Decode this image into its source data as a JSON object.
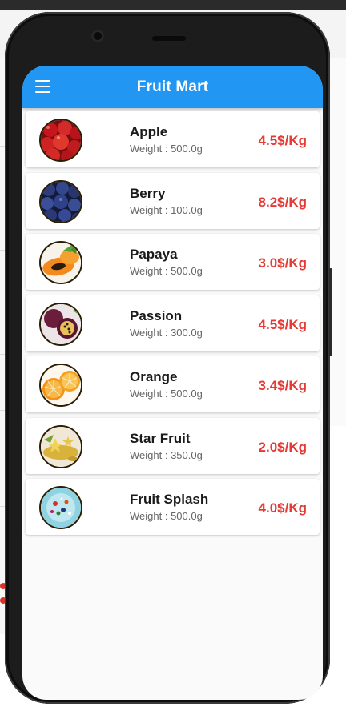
{
  "app": {
    "title": "Fruit Mart"
  },
  "theme": {
    "appbar": "#2196f3",
    "price": "#e53935"
  },
  "weight_label": "Weight : ",
  "items": [
    {
      "name": "Apple",
      "weight": "500.0g",
      "price": "4.5$/Kg",
      "icon": "apple-photo"
    },
    {
      "name": "Berry",
      "weight": "100.0g",
      "price": "8.2$/Kg",
      "icon": "blueberry-photo"
    },
    {
      "name": "Papaya",
      "weight": "500.0g",
      "price": "3.0$/Kg",
      "icon": "papaya-photo"
    },
    {
      "name": "Passion",
      "weight": "300.0g",
      "price": "4.5$/Kg",
      "icon": "passion-fruit-photo"
    },
    {
      "name": "Orange",
      "weight": "500.0g",
      "price": "3.4$/Kg",
      "icon": "orange-photo"
    },
    {
      "name": "Star Fruit",
      "weight": "350.0g",
      "price": "2.0$/Kg",
      "icon": "star-fruit-photo"
    },
    {
      "name": "Fruit Splash",
      "weight": "500.0g",
      "price": "4.0$/Kg",
      "icon": "fruit-splash-photo"
    }
  ]
}
